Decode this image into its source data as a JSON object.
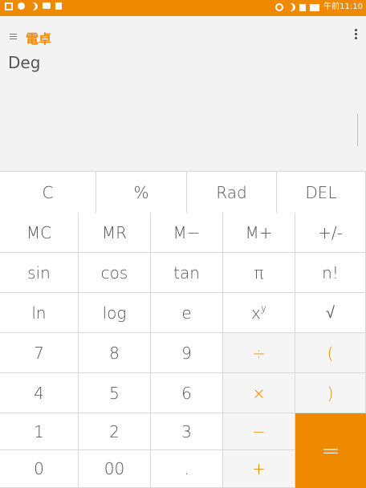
{
  "status_bar": {
    "time": "午前11:10",
    "left_icons": [
      "notification-icon",
      "location-icon",
      "dnd-icon",
      "message-icon",
      "sd-card-icon"
    ],
    "right_icons": [
      "mute-icon",
      "moon-icon",
      "signal-icon",
      "battery-icon"
    ]
  },
  "app": {
    "title": "電卓",
    "angle_mode": "Deg",
    "accent": "#ef8a00"
  },
  "keys": {
    "row0": [
      "C",
      "%",
      "Rad",
      "DEL"
    ],
    "row1": [
      "MC",
      "MR",
      "M−",
      "M+",
      "+/-"
    ],
    "row2": [
      "sin",
      "cos",
      "tan",
      "π",
      "n!"
    ],
    "row3": [
      "ln",
      "log",
      "e",
      "x",
      "√"
    ],
    "row3_power_sup": "y",
    "row4": [
      "7",
      "8",
      "9",
      "÷",
      "("
    ],
    "row5": [
      "4",
      "5",
      "6",
      "×",
      ")"
    ],
    "row6": [
      "1",
      "2",
      "3",
      "−"
    ],
    "row7": [
      "0",
      "00",
      ".",
      "+"
    ],
    "equals": "="
  }
}
